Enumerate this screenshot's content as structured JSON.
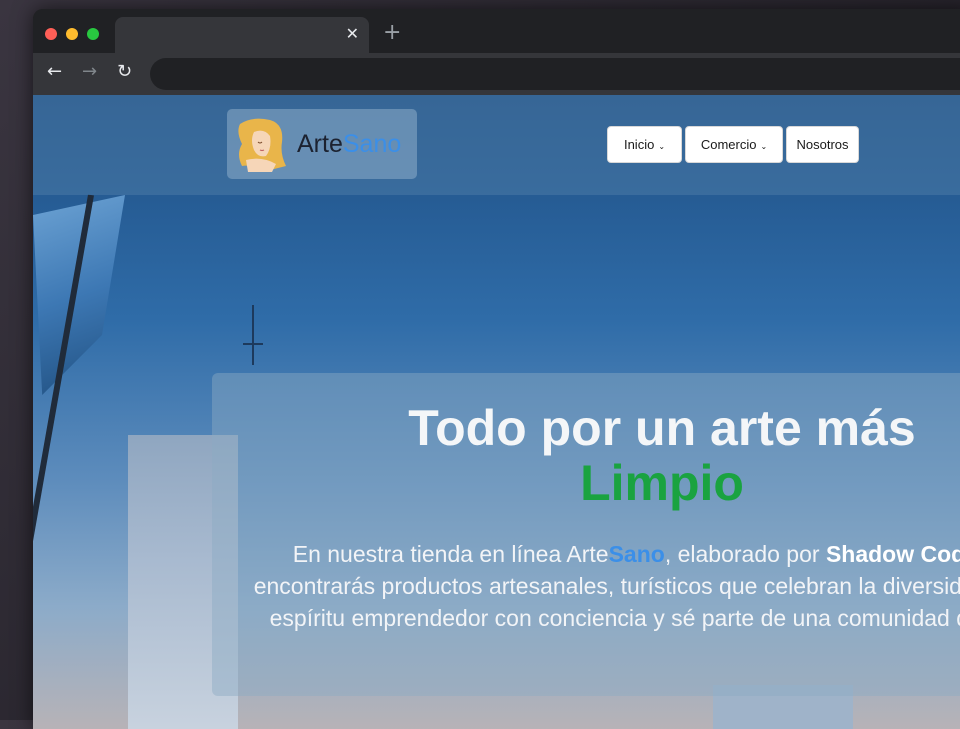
{
  "browser": {
    "tab_close": "✕",
    "new_tab": "+",
    "back": "←",
    "forward": "→",
    "reload": "↻",
    "dots": [
      "#ff5f57",
      "#febc2e",
      "#28c840"
    ]
  },
  "site": {
    "logo_prefix": "Arte",
    "logo_accent": "Sano",
    "nav": [
      {
        "label": "Inicio",
        "caret": "⌄"
      },
      {
        "label": "Comercio",
        "caret": "⌄"
      },
      {
        "label": "Nosotros"
      }
    ]
  },
  "hero": {
    "title_line1": "Todo por un arte más",
    "title_line2": "Limpio",
    "p_before": "En nuestra tienda en línea Arte",
    "p_accent": "Sano",
    "p_middle": ", elaborado por ",
    "p_bold": "Shadow Coding Gang",
    "p_after": ", encontrarás productos artesanales, turísticos que celebran la diversidad cultural y el espíritu emprendedor con conciencia y sé parte de una comunidad que hace la d"
  }
}
